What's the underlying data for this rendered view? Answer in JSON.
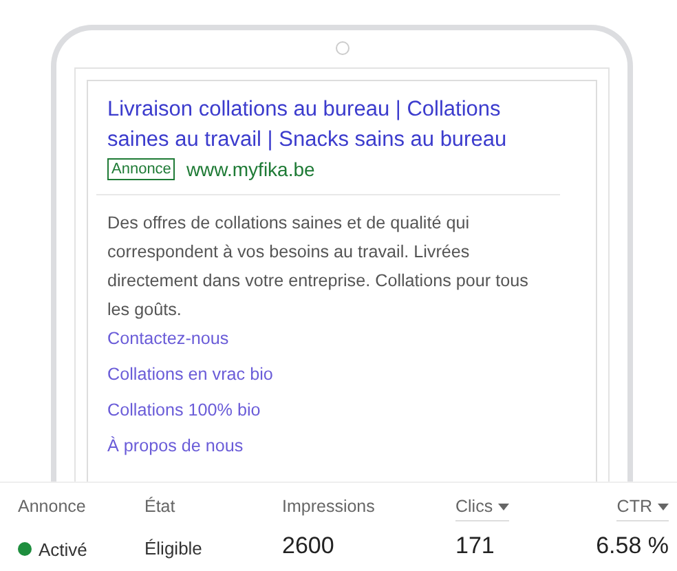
{
  "ad": {
    "headline": "Livraison collations au bureau | Collations saines au travail | Snacks sains au bureau",
    "badge": "Annonce",
    "url": "www.myfika.be",
    "description": "Des offres de collations saines et de qualité qui correspondent à vos besoins au travail. Livrées directement dans votre entreprise. Collations pour tous les goûts.",
    "sitelinks": [
      "Contactez-nous",
      "Collations en vrac bio",
      "Collations 100% bio",
      "À propos de nous"
    ]
  },
  "stats": {
    "columns": [
      {
        "label": "Annonce",
        "sortable": false
      },
      {
        "label": "État",
        "sortable": false
      },
      {
        "label": "Impressions",
        "sortable": false
      },
      {
        "label": "Clics",
        "sortable": true
      },
      {
        "label": "CTR",
        "sortable": true
      }
    ],
    "row": {
      "status": {
        "label": "Activé",
        "color": "#1e8e3e"
      },
      "eligibility": "Éligible",
      "impressions": "2600",
      "clicks": "171",
      "ctr": "6.58 %"
    }
  }
}
